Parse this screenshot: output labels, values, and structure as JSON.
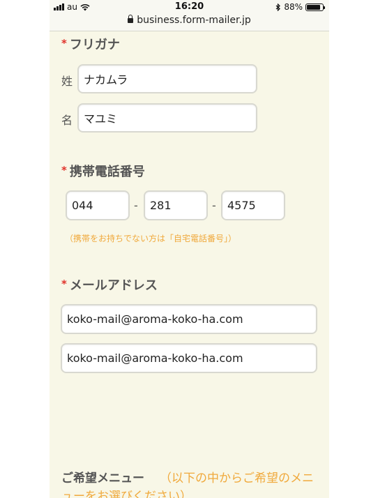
{
  "status_bar": {
    "carrier": "au",
    "time": "16:20",
    "battery": "88%",
    "battery_level": 0.88,
    "url": "business.form-mailer.jp"
  },
  "furigana": {
    "heading": "フリガナ",
    "required_mark": "*",
    "last_label": "姓",
    "last_value": "ナカムラ",
    "first_label": "名",
    "first_value": "マユミ"
  },
  "phone": {
    "heading": "携帯電話番号",
    "required_mark": "*",
    "part1": "044",
    "part2": "281",
    "part3": "4575",
    "separator": "-",
    "note": "（携帯をお持ちでない方は「自宅電話番号」）"
  },
  "email": {
    "heading": "メールアドレス",
    "required_mark": "*",
    "value": "koko-mail@aroma-koko-ha.com",
    "confirm_value": "koko-mail@aroma-koko-ha.com"
  },
  "menu": {
    "label": "ご希望メニュー",
    "hint": "（以下の中からご希望のメニューをお選びください）"
  },
  "colors": {
    "background": "#f8f7e7",
    "required": "#e0322a",
    "accent": "#f0a93c"
  }
}
